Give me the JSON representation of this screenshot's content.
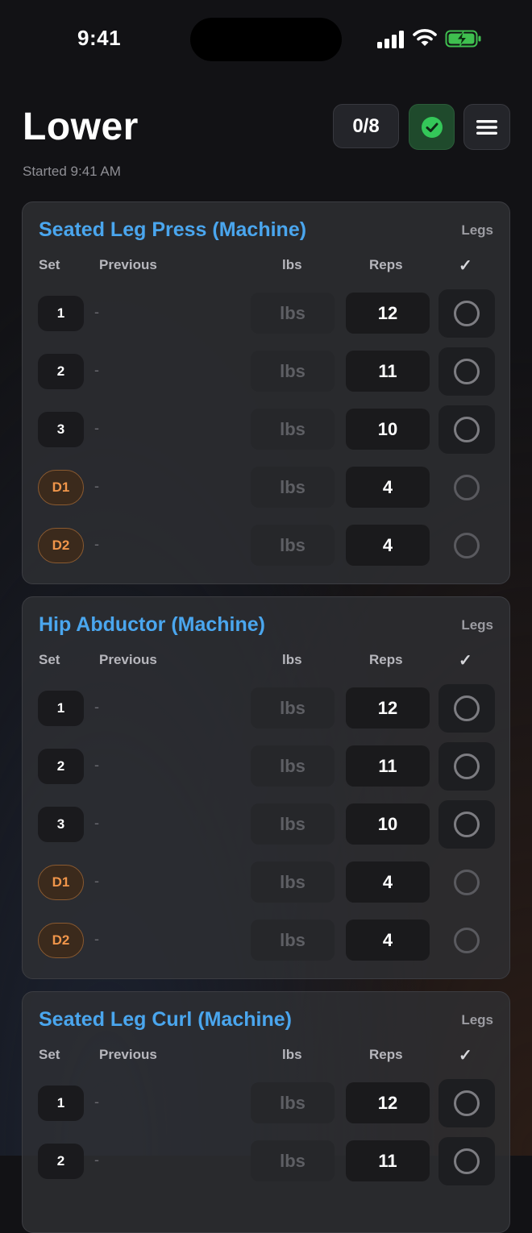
{
  "status_bar": {
    "time": "9:41"
  },
  "header": {
    "title": "Lower",
    "subtitle": "Started 9:41 AM",
    "progress": "0/8"
  },
  "columns": {
    "set": "Set",
    "previous": "Previous",
    "lbs": "lbs",
    "reps": "Reps",
    "done": "✓"
  },
  "exercises": [
    {
      "name": "Seated Leg Press (Machine)",
      "muscle": "Legs",
      "sets": [
        {
          "label": "1",
          "previous": "-",
          "lbs_placeholder": "lbs",
          "reps": "12",
          "type": "normal"
        },
        {
          "label": "2",
          "previous": "-",
          "lbs_placeholder": "lbs",
          "reps": "11",
          "type": "normal"
        },
        {
          "label": "3",
          "previous": "-",
          "lbs_placeholder": "lbs",
          "reps": "10",
          "type": "normal"
        },
        {
          "label": "D1",
          "previous": "-",
          "lbs_placeholder": "lbs",
          "reps": "4",
          "type": "drop"
        },
        {
          "label": "D2",
          "previous": "-",
          "lbs_placeholder": "lbs",
          "reps": "4",
          "type": "drop"
        }
      ]
    },
    {
      "name": "Hip Abductor (Machine)",
      "muscle": "Legs",
      "sets": [
        {
          "label": "1",
          "previous": "-",
          "lbs_placeholder": "lbs",
          "reps": "12",
          "type": "normal"
        },
        {
          "label": "2",
          "previous": "-",
          "lbs_placeholder": "lbs",
          "reps": "11",
          "type": "normal"
        },
        {
          "label": "3",
          "previous": "-",
          "lbs_placeholder": "lbs",
          "reps": "10",
          "type": "normal"
        },
        {
          "label": "D1",
          "previous": "-",
          "lbs_placeholder": "lbs",
          "reps": "4",
          "type": "drop"
        },
        {
          "label": "D2",
          "previous": "-",
          "lbs_placeholder": "lbs",
          "reps": "4",
          "type": "drop"
        }
      ]
    },
    {
      "name": "Seated Leg Curl (Machine)",
      "muscle": "Legs",
      "sets": [
        {
          "label": "1",
          "previous": "-",
          "lbs_placeholder": "lbs",
          "reps": "12",
          "type": "normal"
        },
        {
          "label": "2",
          "previous": "-",
          "lbs_placeholder": "lbs",
          "reps": "11",
          "type": "normal"
        }
      ]
    }
  ],
  "colors": {
    "accent": "#4aa6ee",
    "drop_set": "#f0954a",
    "complete": "#34c759"
  }
}
